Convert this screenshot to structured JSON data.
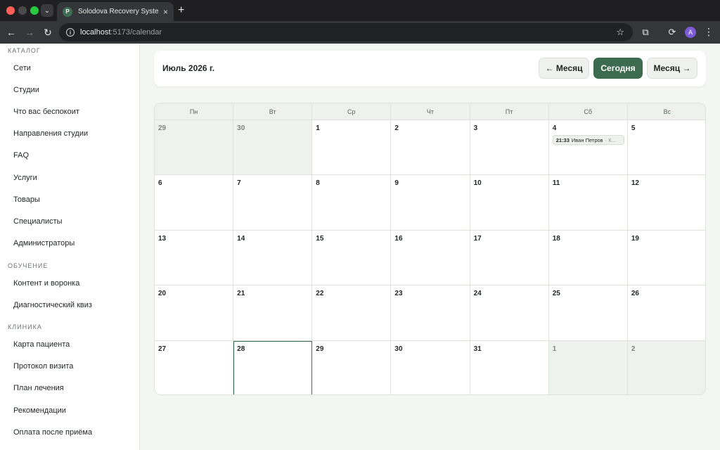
{
  "browser": {
    "tab_title": "Solodova Recovery System A",
    "favicon_letter": "P",
    "url_host": "localhost",
    "url_path": ":5173/calendar",
    "avatar_letter": "A"
  },
  "sidebar": {
    "sections": [
      {
        "title": "КАТАЛОГ",
        "items": [
          "Сети",
          "Студии",
          "Что вас беспокоит",
          "Направления студии",
          "FAQ",
          "Услуги",
          "Товары",
          "Специалисты",
          "Администраторы"
        ]
      },
      {
        "title": "ОБУЧЕНИЕ",
        "items": [
          "Контент и воронка",
          "Диагностический квиз"
        ]
      },
      {
        "title": "КЛИНИКА",
        "items": [
          "Карта пациента",
          "Протокол визита",
          "План лечения",
          "Рекомендации",
          "Оплата после приёма"
        ]
      }
    ]
  },
  "calendar": {
    "month_title": "Июль 2026 г.",
    "prev_label": "← Месяц",
    "today_label": "Сегодня",
    "next_label": "Месяц →",
    "weekdays": [
      "Пн",
      "Вт",
      "Ср",
      "Чт",
      "Пт",
      "Сб",
      "Вс"
    ],
    "days": [
      {
        "n": "29",
        "other": true
      },
      {
        "n": "30",
        "other": true
      },
      {
        "n": "1"
      },
      {
        "n": "2"
      },
      {
        "n": "3"
      },
      {
        "n": "4",
        "event": {
          "time": "21:33",
          "name": "Иван Петров",
          "sep": "· К..."
        }
      },
      {
        "n": "5"
      },
      {
        "n": "6"
      },
      {
        "n": "7"
      },
      {
        "n": "8"
      },
      {
        "n": "9"
      },
      {
        "n": "10"
      },
      {
        "n": "11"
      },
      {
        "n": "12"
      },
      {
        "n": "13"
      },
      {
        "n": "14"
      },
      {
        "n": "15"
      },
      {
        "n": "16"
      },
      {
        "n": "17"
      },
      {
        "n": "18"
      },
      {
        "n": "19"
      },
      {
        "n": "20"
      },
      {
        "n": "21"
      },
      {
        "n": "22"
      },
      {
        "n": "23"
      },
      {
        "n": "24"
      },
      {
        "n": "25"
      },
      {
        "n": "26"
      },
      {
        "n": "27"
      },
      {
        "n": "28",
        "today": true
      },
      {
        "n": "29"
      },
      {
        "n": "30"
      },
      {
        "n": "31"
      },
      {
        "n": "1",
        "other": true
      },
      {
        "n": "2",
        "other": true
      }
    ]
  },
  "colors": {
    "accent": "#3d6b4f",
    "other_month_bg": "#eef1ee"
  },
  "icons": {
    "back": "arrow-left-icon",
    "forward": "arrow-right-icon",
    "reload": "reload-icon",
    "info": "info-icon",
    "star": "star-icon",
    "extensions": "puzzle-icon",
    "menu": "kebab-icon"
  }
}
